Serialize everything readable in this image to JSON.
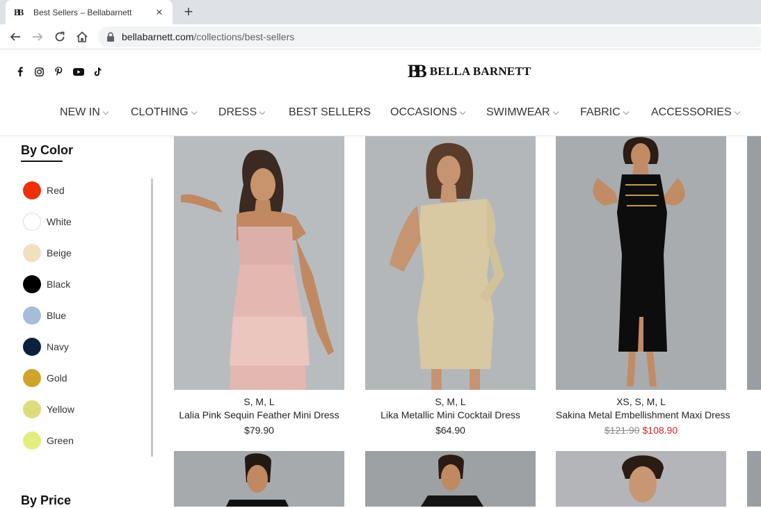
{
  "browser": {
    "tab_title": "Best Sellers – Bellabarnett",
    "favicon_text": "BB",
    "url_host": "bellabarnett.com",
    "url_path": "/collections/best-sellers"
  },
  "header": {
    "social_icons": [
      "facebook-icon",
      "instagram-icon",
      "pinterest-icon",
      "youtube-icon",
      "tiktok-icon"
    ],
    "brand_mark": "BB",
    "brand_name": "BELLA BARNETT",
    "nav": [
      {
        "label": "NEW IN",
        "dropdown": true
      },
      {
        "label": "CLOTHING",
        "dropdown": true
      },
      {
        "label": "DRESS",
        "dropdown": true
      },
      {
        "label": "BEST SELLERS",
        "dropdown": false
      },
      {
        "label": "OCCASIONS",
        "dropdown": true
      },
      {
        "label": "SWIMWEAR",
        "dropdown": true
      },
      {
        "label": "FABRIC",
        "dropdown": true
      },
      {
        "label": "ACCESSORIES",
        "dropdown": true
      }
    ]
  },
  "sidebar": {
    "color_title": "By Color",
    "colors": [
      {
        "label": "Red",
        "hex": "#f0300a"
      },
      {
        "label": "White",
        "hex": "#ffffff"
      },
      {
        "label": "Beige",
        "hex": "#f1dfc0"
      },
      {
        "label": "Black",
        "hex": "#000000"
      },
      {
        "label": "Blue",
        "hex": "#a6bcd8"
      },
      {
        "label": "Navy",
        "hex": "#0c1f3d"
      },
      {
        "label": "Gold",
        "hex": "#d1a32a"
      },
      {
        "label": "Yellow",
        "hex": "#dcdc7c"
      },
      {
        "label": "Green",
        "hex": "#e3ee7c"
      }
    ],
    "price_title": "By Price"
  },
  "products": [
    {
      "sizes": "S, M, L",
      "name": "Lalia Pink Sequin Feather Mini Dress",
      "price": "$79.90",
      "old_price": "",
      "sale_price": ""
    },
    {
      "sizes": "S, M, L",
      "name": "Lika Metallic Mini Cocktail Dress",
      "price": "$64.90",
      "old_price": "",
      "sale_price": ""
    },
    {
      "sizes": "XS, S, M, L",
      "name": "Sakina Metal Embellishment Maxi Dress",
      "price": "",
      "old_price": "$121.90",
      "sale_price": "$108.90"
    }
  ]
}
